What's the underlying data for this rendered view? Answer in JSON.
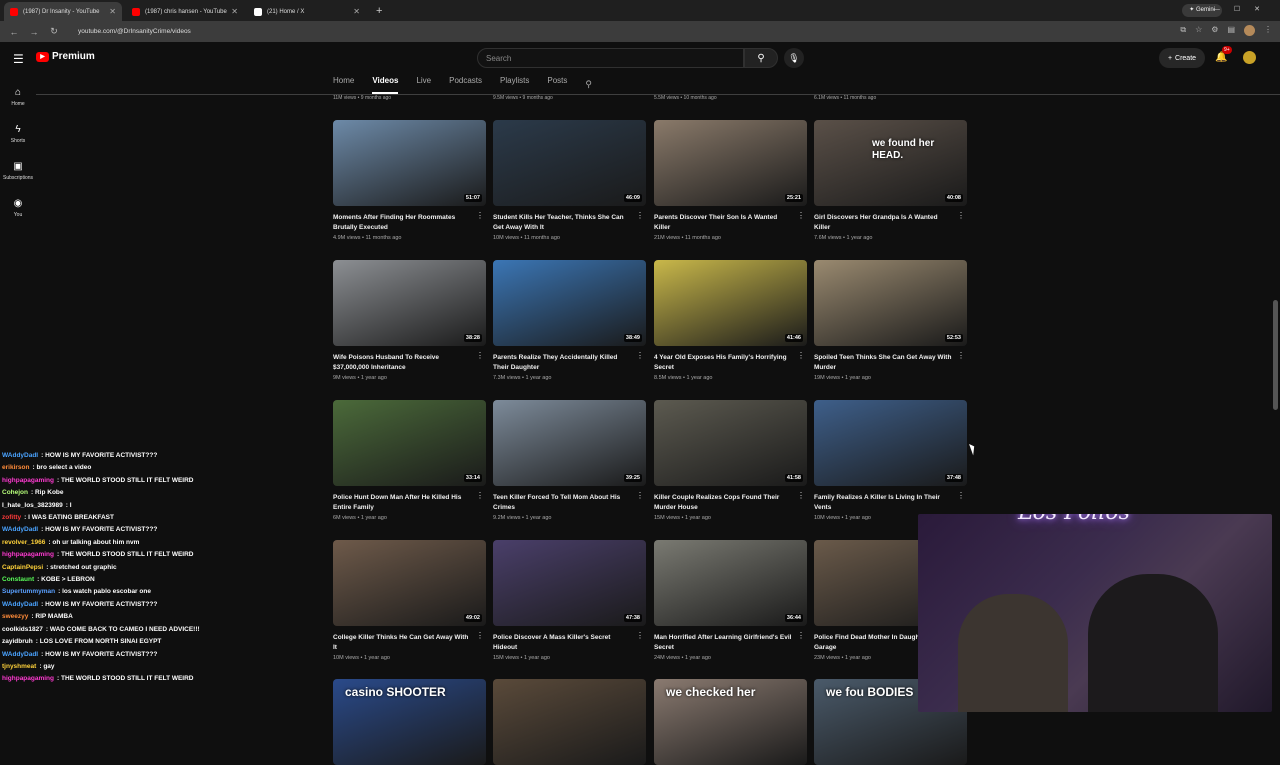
{
  "browser": {
    "tabs": [
      {
        "label": "(1987) Dr Insanity - YouTube",
        "color": "#ff0000",
        "active": true
      },
      {
        "label": "(1987) chris hansen - YouTube",
        "color": "#ff0000",
        "active": false
      },
      {
        "label": "(21) Home / X",
        "color": "#ffffff",
        "active": false
      }
    ],
    "new_tab": "+",
    "gemini_label": "Gemini",
    "url": "youtube.com/@DrInsanityCrime/videos"
  },
  "header": {
    "logo_text": "Premium",
    "search_placeholder": "Search",
    "create_label": "Create",
    "notif_badge": "9+"
  },
  "sidebar": {
    "items": [
      {
        "label": "Home",
        "icon": "home-icon"
      },
      {
        "label": "Shorts",
        "icon": "shorts-icon"
      },
      {
        "label": "Subscriptions",
        "icon": "subscriptions-icon"
      },
      {
        "label": "You",
        "icon": "you-icon"
      }
    ]
  },
  "channel_tabs": [
    "Home",
    "Videos",
    "Live",
    "Podcasts",
    "Playlists",
    "Posts"
  ],
  "prev_row_meta": [
    "11M views • 9 months ago",
    "9.5M views • 9 months ago",
    "5.5M views • 10 months ago",
    "6.1M views • 11 months ago"
  ],
  "videos": [
    {
      "title": "Moments After Finding Her Roommates Brutally Executed",
      "meta": "4.9M views • 11 months ago",
      "duration": "51:07",
      "thumb": "#6d8aa8"
    },
    {
      "title": "Student Kills Her Teacher, Thinks She Can Get Away With It",
      "meta": "10M views • 11 months ago",
      "duration": "46:09",
      "thumb": "#2b3a4a"
    },
    {
      "title": "Parents Discover Their Son Is A Wanted Killer",
      "meta": "21M views • 11 months ago",
      "duration": "25:21",
      "thumb": "#8a7a6a"
    },
    {
      "title": "Girl Discovers Her Grandpa Is A Wanted Killer",
      "meta": "7.6M views • 1 year ago",
      "duration": "40:08",
      "thumb": "#5a5048"
    },
    {
      "title": "Wife Poisons Husband To Receive $37,000,000 Inheritance",
      "meta": "9M views • 1 year ago",
      "duration": "38:28",
      "thumb": "#8c8f93"
    },
    {
      "title": "Parents Realize They Accidentally Killed Their Daughter",
      "meta": "7.3M views • 1 year ago",
      "duration": "38:49",
      "thumb": "#3b76b5"
    },
    {
      "title": "4 Year Old Exposes His Family's Horrifying Secret",
      "meta": "8.5M views • 1 year ago",
      "duration": "41:46",
      "thumb": "#c9b84a"
    },
    {
      "title": "Spoiled Teen Thinks She Can Get Away With Murder",
      "meta": "19M views • 1 year ago",
      "duration": "52:53",
      "thumb": "#9a8a70"
    },
    {
      "title": "Police Hunt Down Man After He Killed His Entire Family",
      "meta": "6M views • 1 year ago",
      "duration": "33:14",
      "thumb": "#4b6a3a"
    },
    {
      "title": "Teen Killer Forced To Tell Mom About His Crimes",
      "meta": "9.2M views • 1 year ago",
      "duration": "39:25",
      "thumb": "#7d8b9a"
    },
    {
      "title": "Killer Couple Realizes Cops Found Their Murder House",
      "meta": "15M views • 1 year ago",
      "duration": "41:58",
      "thumb": "#5c5a50"
    },
    {
      "title": "Family Realizes A Killer Is Living In Their Vents",
      "meta": "10M views • 1 year ago",
      "duration": "37:48",
      "thumb": "#3e5f8a"
    },
    {
      "title": "College Killer Thinks He Can Get Away With It",
      "meta": "10M views • 1 year ago",
      "duration": "49:02",
      "thumb": "#6e5a4a"
    },
    {
      "title": "Police Discover A Mass Killer's Secret Hideout",
      "meta": "15M views • 1 year ago",
      "duration": "47:38",
      "thumb": "#4a3f6a"
    },
    {
      "title": "Man Horrified After Learning Girlfriend's Evil Secret",
      "meta": "24M views • 1 year ago",
      "duration": "36:44",
      "thumb": "#7a7a72"
    },
    {
      "title": "Police Find Dead Mother In Daughter's Garage",
      "meta": "23M views • 1 year ago",
      "duration": "",
      "thumb": "#6a5a4a"
    },
    {
      "title": "",
      "meta": "",
      "duration": "",
      "thumb": "#2a4a8a",
      "overlay": "casino SHOOTER"
    },
    {
      "title": "",
      "meta": "",
      "duration": "",
      "thumb": "#5a4a3a"
    },
    {
      "title": "",
      "meta": "",
      "duration": "",
      "thumb": "#8a7a70",
      "overlay": "we checked her"
    },
    {
      "title": "",
      "meta": "",
      "duration": "",
      "thumb": "#4a5a6a",
      "overlay": "we fou BODIES"
    }
  ],
  "thumb_overlays": {
    "card3": "we found her HEAD."
  },
  "chat": [
    {
      "user": "WAddyDadI",
      "color": "#4aa3ff",
      "text": "HOW IS MY FAVORITE ACTIVIST???"
    },
    {
      "user": "erikirson",
      "color": "#ff8c3a",
      "text": "bro select a video"
    },
    {
      "user": "highpapagaming",
      "color": "#ff3ad1",
      "text": "THE WORLD STOOD STILL IT FELT WEIRD"
    },
    {
      "user": "Cohejon",
      "color": "#b7ff7a",
      "text": "Rip Kobe"
    },
    {
      "user": "I_hate_los_3823989",
      "color": "#ffffff",
      "text": "I"
    },
    {
      "user": "zofitty",
      "color": "#ff3a3a",
      "text": "I WAS EATING BREAKFAST"
    },
    {
      "user": "WAddyDadI",
      "color": "#4aa3ff",
      "text": "HOW IS MY FAVORITE ACTIVIST???"
    },
    {
      "user": "revolver_1966",
      "color": "#ffd23a",
      "text": "oh ur talking about him nvm"
    },
    {
      "user": "highpapagaming",
      "color": "#ff3ad1",
      "text": "THE WORLD STOOD STILL IT FELT WEIRD"
    },
    {
      "user": "CaptainPepsi",
      "color": "#ffd23a",
      "text": "stretched out graphic"
    },
    {
      "user": "Constaunt",
      "color": "#5aff5a",
      "text": "KOBE > LEBRON"
    },
    {
      "user": "Supertummyman",
      "color": "#5aa0ff",
      "text": "los watch pablo escobar one"
    },
    {
      "user": "WAddyDadI",
      "color": "#4aa3ff",
      "text": "HOW IS MY FAVORITE ACTIVIST???"
    },
    {
      "user": "sweezyy",
      "color": "#ff8c3a",
      "text": "RIP MAMBA"
    },
    {
      "user": "coolkids1827",
      "color": "#ffffff",
      "text": "WAD COME BACK TO CAMEO I NEED ADVICE!!!"
    },
    {
      "user": "zayidbruh",
      "color": "#ffffff",
      "text": "LOS LOVE FROM NORTH SINAI EGYPT"
    },
    {
      "user": "WAddyDadI",
      "color": "#4aa3ff",
      "text": "HOW IS MY FAVORITE ACTIVIST???"
    },
    {
      "user": "tjnyshmeat",
      "color": "#ffd23a",
      "text": "gay"
    },
    {
      "user": "highpapagaming",
      "color": "#ff3ad1",
      "text": "THE WORLD STOOD STILL IT FELT WEIRD"
    }
  ],
  "webcam_neon": "Los Pollos"
}
